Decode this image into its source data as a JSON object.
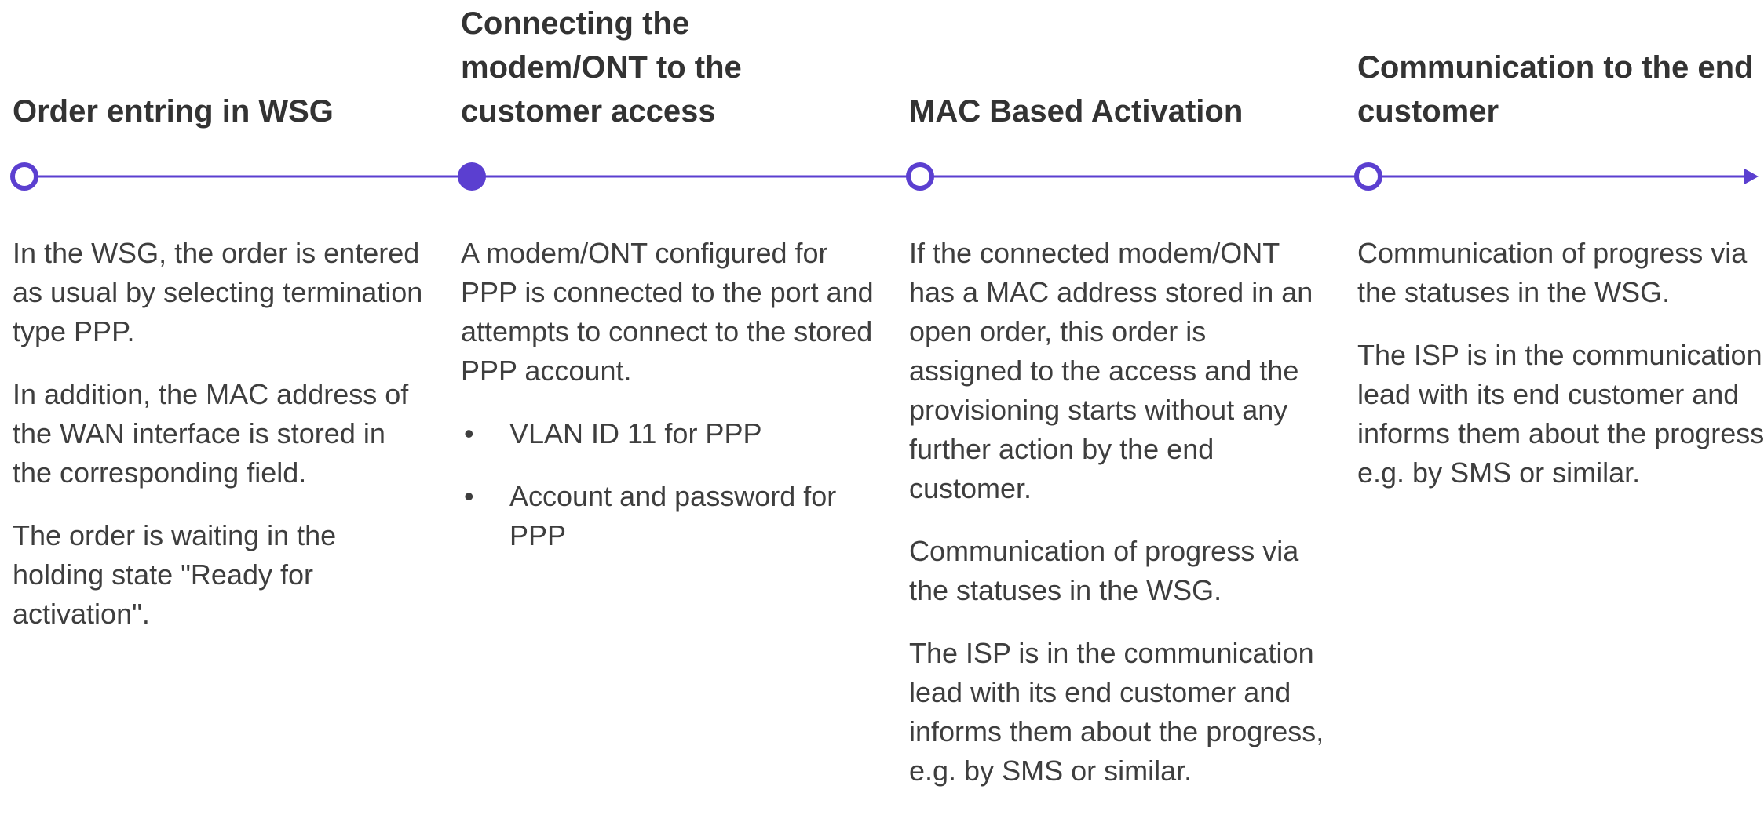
{
  "accent_color": "#5b3fd0",
  "steps": [
    {
      "title_lines": [
        "Order entring in WSG"
      ],
      "marker": "hollow",
      "paragraphs": [
        "In the WSG, the order is entered as usual by selecting termination type PPP.",
        "In addition, the MAC address of the WAN interface is stored in the corresponding field.",
        "The order is waiting in the holding state \"Ready for activation\"."
      ],
      "bullets": []
    },
    {
      "title_lines": [
        "Connecting the",
        "modem/ONT to the",
        "customer access"
      ],
      "marker": "filled",
      "paragraphs": [
        "A modem/ONT configured for PPP is connected to the port and attempts to connect to the stored PPP account."
      ],
      "bullets": [
        "VLAN ID 11 for PPP",
        "Account and password for PPP"
      ]
    },
    {
      "title_lines": [
        "MAC Based Activation"
      ],
      "marker": "hollow",
      "paragraphs": [
        "If the connected modem/ONT has a MAC address stored in an open order, this order is assigned to the access and the provisioning starts without any further action by the end customer.",
        "Communication of progress via the statuses in the WSG.",
        "The ISP is in the communication lead with its end customer and informs them about the progress, e.g. by SMS or similar."
      ],
      "bullets": []
    },
    {
      "title_lines": [
        "Communication to the end",
        "customer"
      ],
      "marker": "hollow",
      "paragraphs": [
        "Communication of progress via the statuses in the WSG.",
        "The ISP is in the communication lead with its end customer and informs them about the progress, e.g. by SMS or similar."
      ],
      "bullets": []
    }
  ],
  "bullet_glyph": "•"
}
